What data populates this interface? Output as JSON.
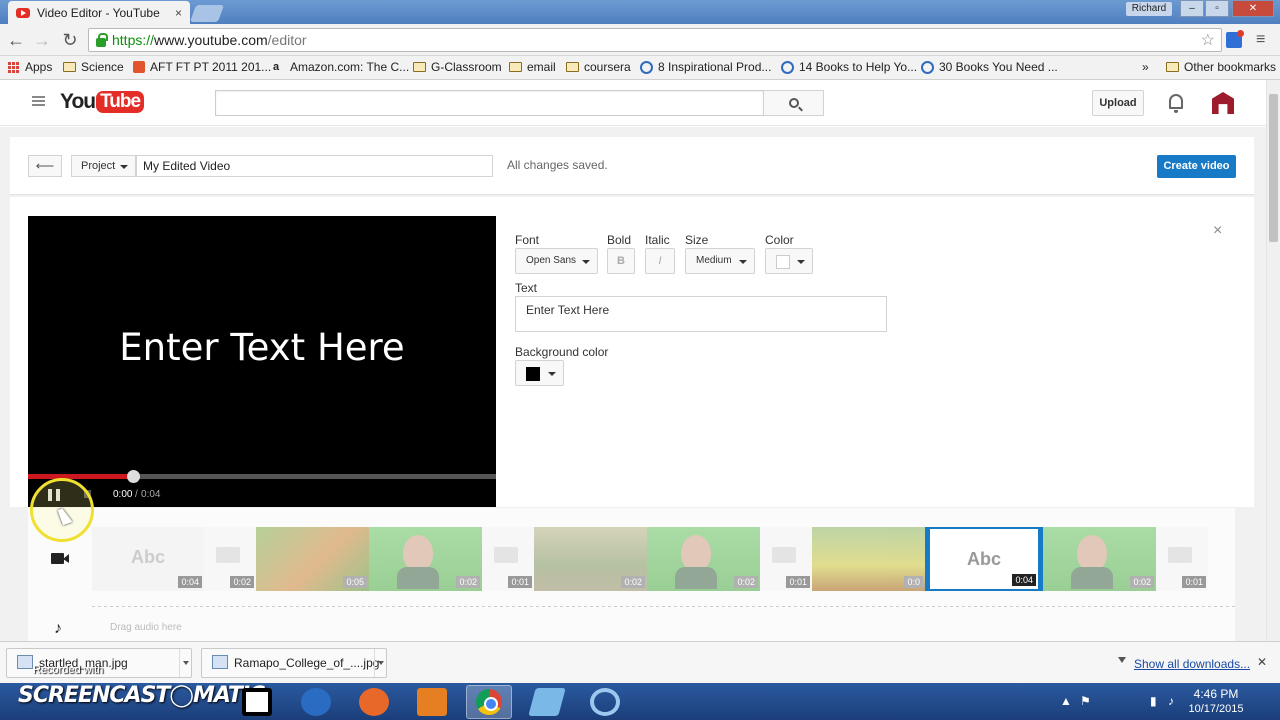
{
  "browser": {
    "tab_title": "Video Editor - YouTube",
    "tab_close": "×",
    "user_badge": "Richard",
    "win_min": "–",
    "win_max": "▫",
    "win_close": "✕",
    "url_scheme": "https://",
    "url_host": "www.youtube.com",
    "url_path": "/editor",
    "back_glyph": "←",
    "forward_glyph": "→",
    "reload_glyph": "↻",
    "star_glyph": "☆",
    "menu_glyph": "≡"
  },
  "bookmarks": {
    "apps": "Apps",
    "items": [
      {
        "label": "Science",
        "icon": "folder-icon"
      },
      {
        "label": "AFT FT PT 2011 201...",
        "icon": "page-icon"
      },
      {
        "label": "Amazon.com: The C...",
        "icon": "amazon-icon"
      },
      {
        "label": "G-Classroom",
        "icon": "folder-icon"
      },
      {
        "label": "email",
        "icon": "folder-icon"
      },
      {
        "label": "coursera",
        "icon": "folder-icon"
      },
      {
        "label": "8 Inspirational Prod...",
        "icon": "circle-icon"
      },
      {
        "label": "14 Books to Help Yo...",
        "icon": "circle-icon"
      },
      {
        "label": "30 Books You Need ...",
        "icon": "circle-icon"
      }
    ],
    "overflow": "»",
    "other": "Other bookmarks"
  },
  "youtube": {
    "logo_you": "You",
    "logo_tube": "Tube",
    "search_placeholder": "",
    "upload_label": "Upload"
  },
  "project": {
    "back_glyph": "⟵",
    "dropdown_label": "Project",
    "name": "My Edited Video",
    "status": "All changes saved.",
    "create_label": "Create video"
  },
  "player": {
    "overlay_text": "Enter Text Here",
    "progress": 0.225,
    "time_current": "0:00",
    "time_sep": "/",
    "time_total": "0:04"
  },
  "text_panel": {
    "font_label": "Font",
    "font_value": "Open Sans",
    "bold_label": "Bold",
    "bold_glyph": "B",
    "italic_label": "Italic",
    "italic_glyph": "I",
    "size_label": "Size",
    "size_value": "Medium",
    "color_label": "Color",
    "color_value": "#ffffff",
    "text_label": "Text",
    "text_value": "Enter Text Here",
    "bg_label": "Background color",
    "bg_value": "#000000",
    "close_glyph": "×"
  },
  "timeline": {
    "audio_hint": "Drag audio here",
    "audio_glyph": "♪",
    "clips": [
      {
        "type": "title",
        "label": "Abc",
        "duration": "0:04"
      },
      {
        "type": "transition",
        "duration": "0:02"
      },
      {
        "type": "video",
        "scene": "flowers",
        "duration": "0:05"
      },
      {
        "type": "video",
        "scene": "face",
        "duration": "0:02"
      },
      {
        "type": "transition",
        "duration": "0:01"
      },
      {
        "type": "video",
        "scene": "street",
        "duration": "0:02"
      },
      {
        "type": "video",
        "scene": "face",
        "duration": "0:02"
      },
      {
        "type": "transition",
        "duration": "0:01"
      },
      {
        "type": "video",
        "scene": "garden",
        "duration": "0:0"
      },
      {
        "type": "title",
        "label": "Abc",
        "duration": "0:04",
        "selected": true
      },
      {
        "type": "video",
        "scene": "face",
        "duration": "0:02"
      },
      {
        "type": "transition",
        "duration": "0:01"
      }
    ]
  },
  "downloads": {
    "items": [
      "startled_man.jpg",
      "Ramapo_College_of_....jpg"
    ],
    "show_all": "Show all downloads...",
    "close_glyph": "✕"
  },
  "taskbar": {
    "recorded_with": "Recorded with",
    "screencast_logo": "SCREENCAST◯MATIC",
    "time": "4:46 PM",
    "date": "10/17/2015"
  },
  "colors": {
    "accent": "#167ac6",
    "brand_red": "#e52d27",
    "progress_red": "#cc181e"
  }
}
